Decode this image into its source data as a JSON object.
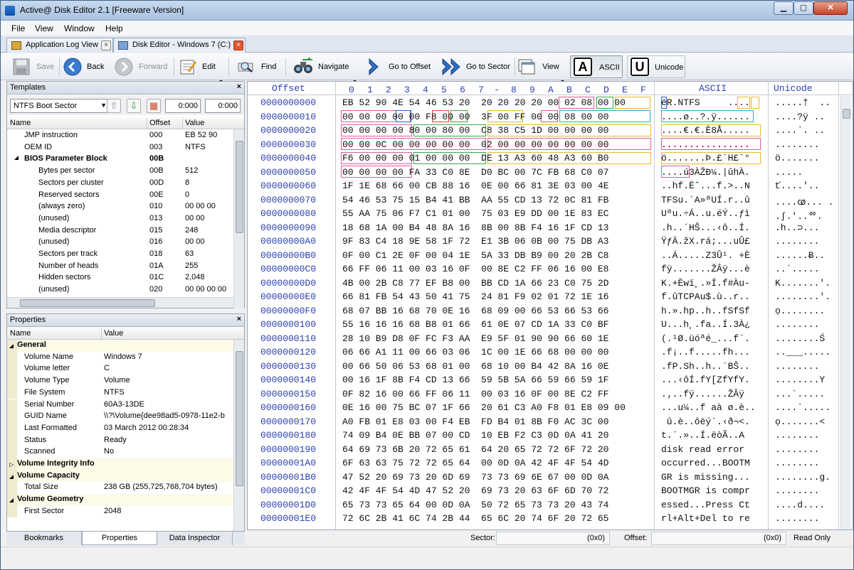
{
  "window": {
    "title": "Active@ Disk Editor 2.1 [Freeware Version]"
  },
  "menu": [
    "File",
    "View",
    "Window",
    "Help"
  ],
  "tabs": [
    {
      "label": "Application Log View"
    },
    {
      "label": "Disk Editor - Windows 7 (C:)"
    }
  ],
  "toolbar": {
    "save": "Save",
    "back": "Back",
    "forward": "Forward",
    "edit": "Edit",
    "find": "Find",
    "navigate": "Navigate",
    "go_offset": "Go to Offset",
    "go_sector": "Go to Sector",
    "view": "View",
    "ascii": "ASCII",
    "unicode": "Unicode",
    "ascii_glyph": "A",
    "unicode_glyph": "U"
  },
  "templates": {
    "title": "Templates",
    "close": "×",
    "selected": "NTFS Boot Sector",
    "field1": "0:000",
    "field2": "0:000",
    "columns": [
      "Name",
      "Offset",
      "Value"
    ],
    "rows": [
      {
        "name": "JMP instruction",
        "offset": "000",
        "value": "EB 52 90"
      },
      {
        "name": "OEM ID",
        "offset": "003",
        "value": "NTFS"
      },
      {
        "name": "BIOS Parameter Block",
        "offset": "00B",
        "value": ""
      },
      {
        "name": "Bytes per sector",
        "offset": "00B",
        "value": "512"
      },
      {
        "name": "Sectors per cluster",
        "offset": "00D",
        "value": "8"
      },
      {
        "name": "Reserved sectors",
        "offset": "00E",
        "value": "0"
      },
      {
        "name": "(always zero)",
        "offset": "010",
        "value": "00 00 00"
      },
      {
        "name": "(unused)",
        "offset": "013",
        "value": "00 00"
      },
      {
        "name": "Media descriptor",
        "offset": "015",
        "value": "248"
      },
      {
        "name": "(unused)",
        "offset": "016",
        "value": "00 00"
      },
      {
        "name": "Sectors per track",
        "offset": "018",
        "value": "63"
      },
      {
        "name": "Number of heads",
        "offset": "01A",
        "value": "255"
      },
      {
        "name": "Hidden sectors",
        "offset": "01C",
        "value": "2,048"
      },
      {
        "name": "(unused)",
        "offset": "020",
        "value": "00 00 00 00"
      }
    ]
  },
  "properties": {
    "title": "Properties",
    "close": "×",
    "columns": [
      "Name",
      "Value"
    ],
    "rows": [
      {
        "name": "General",
        "value": "",
        "cat": true,
        "exp": "◢"
      },
      {
        "name": "Volume Name",
        "value": "Windows 7"
      },
      {
        "name": "Volume letter",
        "value": "C"
      },
      {
        "name": "Volume Type",
        "value": "Volume"
      },
      {
        "name": "File System",
        "value": "NTFS"
      },
      {
        "name": "Serial Number",
        "value": "60A3-13DE"
      },
      {
        "name": "GUID Name",
        "value": "\\\\?\\Volume{dee98ad5-0978-11e2-b"
      },
      {
        "name": "Last Formatted",
        "value": "03 March 2012 00:28:34"
      },
      {
        "name": "Status",
        "value": "Ready"
      },
      {
        "name": "Scanned",
        "value": "No"
      },
      {
        "name": "Volume Integrity Info",
        "value": "",
        "cat": true,
        "exp": "▷"
      },
      {
        "name": "Volume Capacity",
        "value": "",
        "cat": true,
        "exp": "◢"
      },
      {
        "name": "Total Size",
        "value": "238 GB (255,725,768,704 bytes)"
      },
      {
        "name": "Volume Geometry",
        "value": "",
        "cat": true,
        "exp": "◢"
      },
      {
        "name": "First Sector",
        "value": "2048"
      }
    ]
  },
  "panel_tabs": [
    "Bookmarks",
    "Properties",
    "Data Inspector"
  ],
  "hex": {
    "header": {
      "offset": "Offset",
      "cols": [
        "0",
        "1",
        "2",
        "3",
        "4",
        "5",
        "6",
        "7",
        "-",
        "8",
        "9",
        "A",
        "B",
        "C",
        "D",
        "E",
        "F"
      ],
      "ascii": "ASCII",
      "unicode": "Unicode"
    },
    "rows": [
      {
        "off": "0000000000",
        "hex": "EB 52 90 4E 54 46 53 20  20 20 20 20 00 02 08 00 00",
        "asc": "ëR.NTFS     ....",
        "uni": ".....†  .."
      },
      {
        "off": "0000000010",
        "hex": "00 00 00 00 00 F8 00 00  3F 00 FF 00 00 08 00 00",
        "asc": "....ø..?.ÿ......",
        "uni": "....?ÿ .."
      },
      {
        "off": "0000000020",
        "hex": "00 00 00 00 80 00 80 00  C8 38 C5 1D 00 00 00 00",
        "asc": "....€.€.È8Å.....",
        "uni": "....`. .."
      },
      {
        "off": "0000000030",
        "hex": "00 00 0C 00 00 00 00 00  02 00 00 00 00 00 00 00",
        "asc": "................",
        "uni": "........"
      },
      {
        "off": "0000000040",
        "hex": "F6 00 00 00 01 00 00 00  DE 13 A3 60 48 A3 60 B0",
        "asc": "ö.......Þ.£`H£`°",
        "uni": "ö......."
      },
      {
        "off": "0000000050",
        "hex": "00 00 00 00 FA 33 C0 8E  D0 BC 00 7C FB 68 C0 07",
        "asc": "....ú3ÀŽÐ¼.|ûhÀ.",
        "uni": "....."
      },
      {
        "off": "0000000060",
        "hex": "1F 1E 68 66 00 CB 88 16  0E 00 66 81 3E 03 00 4E",
        "asc": "..hf.Ëˆ...f.>..N",
        "uni": "ť....'.."
      },
      {
        "off": "0000000070",
        "hex": "54 46 53 75 15 B4 41 BB  AA 55 CD 13 72 0C 81 FB",
        "asc": "TFSu.´A»ªUÍ.r..û",
        "uni": "....ꭄ... ."
      },
      {
        "off": "0000000080",
        "hex": "55 AA 75 06 F7 C1 01 00  75 03 E9 DD 00 1E 83 EC",
        "asc": "Uªu.÷Á..u.éÝ..ƒì",
        "uni": ".ʃ.'..ᅇ."
      },
      {
        "off": "0000000090",
        "hex": "18 68 1A 00 B4 48 8A 16  8B 00 8B F4 16 1F CD 13",
        "asc": ".h..´HŠ...‹ô..Í.",
        "uni": ".h..⊃..."
      },
      {
        "off": "00000000A0",
        "hex": "9F 83 C4 18 9E 58 1F 72  E1 3B 06 0B 00 75 DB A3",
        "asc": "ŸƒÄ.žX.rá;...uÛ£",
        "uni": "........"
      },
      {
        "off": "00000000B0",
        "hex": "0F 00 C1 2E 0F 00 04 1E  5A 33 DB B9 00 20 2B C8",
        "asc": "..Á.....Z3Û¹. +È",
        "uni": "......Ƀ.."
      },
      {
        "off": "00000000C0",
        "hex": "66 FF 06 11 00 03 16 0F  00 8E C2 FF 06 16 00 E8",
        "asc": "fÿ.......ŽÂÿ...è",
        "uni": "..`....."
      },
      {
        "off": "00000000D0",
        "hex": "4B 00 2B C8 77 EF B8 00  BB CD 1A 66 23 C0 75 2D",
        "asc": "K.+Èwï¸.»Í.f#Àu-",
        "uni": "K.......'."
      },
      {
        "off": "00000000E0",
        "hex": "66 81 FB 54 43 50 41 75  24 81 F9 02 01 72 1E 16",
        "asc": "f.ûTCPAu$.ù..r..",
        "uni": "........'."
      },
      {
        "off": "00000000F0",
        "hex": "68 07 BB 16 68 70 0E 16  68 09 00 66 53 66 53 66",
        "asc": "h.».hp..h..fSfSf",
        "uni": "ọ........"
      },
      {
        "off": "0000000100",
        "hex": "55 16 16 16 68 B8 01 66  61 0E 07 CD 1A 33 C0 BF",
        "asc": "U...h¸.fa..Í.3À¿",
        "uni": "........"
      },
      {
        "off": "0000000110",
        "hex": "28 10 B9 D8 0F FC F3 AA  E9 5F 01 90 90 66 60 1E",
        "asc": "(.¹Ø.üóªé_...f`.",
        "uni": "........Ś"
      },
      {
        "off": "0000000120",
        "hex": "06 66 A1 11 00 66 03 06  1C 00 1E 66 68 00 00 00",
        "asc": ".f¡..f.....fh...",
        "uni": "..___....."
      },
      {
        "off": "0000000130",
        "hex": "00 66 50 06 53 68 01 00  68 10 00 B4 42 8A 16 0E",
        "asc": ".fP.Sh..h..´BŠ..",
        "uni": "........"
      },
      {
        "off": "0000000140",
        "hex": "00 16 1F 8B F4 CD 13 66  59 5B 5A 66 59 66 59 1F",
        "asc": "...‹ôÍ.fY[ZfYfY.",
        "uni": "........Y"
      },
      {
        "off": "0000000150",
        "hex": "0F 82 16 00 66 FF 06 11  00 03 16 0F 00 8E C2 FF",
        "asc": ".‚..fÿ......ŽÂÿ",
        "uni": "...`....."
      },
      {
        "off": "0000000160",
        "hex": "0E 16 00 75 BC 07 1F 66  20 61 C3 A0 F8 01 E8 09 00",
        "asc": "...u¼..f aà ø.è..",
        "uni": "....`....."
      },
      {
        "off": "0000000170",
        "hex": "A0 FB 01 E8 03 00 F4 EB  FD B4 01 8B F0 AC 3C 00",
        "asc": " û.è..ôëý´.‹ð¬<.",
        "uni": "ọ.......<"
      },
      {
        "off": "0000000180",
        "hex": "74 09 B4 0E BB 07 00 CD  10 EB F2 C3 0D 0A 41 20",
        "asc": "t.´.»..Í.ëòÃ..A ",
        "uni": "........"
      },
      {
        "off": "0000000190",
        "hex": "64 69 73 6B 20 72 65 61  64 20 65 72 72 6F 72 20",
        "asc": "disk read error ",
        "uni": "........"
      },
      {
        "off": "00000001A0",
        "hex": "6F 63 63 75 72 72 65 64  00 0D 0A 42 4F 4F 54 4D",
        "asc": "occurred...BOOTM",
        "uni": "........"
      },
      {
        "off": "00000001B0",
        "hex": "47 52 20 69 73 20 6D 69  73 73 69 6E 67 00 0D 0A",
        "asc": "GR is missing...",
        "uni": "........g."
      },
      {
        "off": "00000001C0",
        "hex": "42 4F 4F 54 4D 47 52 20  69 73 20 63 6F 6D 70 72",
        "asc": "BOOTMGR is compr",
        "uni": "........"
      },
      {
        "off": "00000001D0",
        "hex": "65 73 73 65 64 00 0D 0A  50 72 65 73 73 20 43 74",
        "asc": "essed...Press Ct",
        "uni": "....d...."
      },
      {
        "off": "00000001E0",
        "hex": "72 6C 2B 41 6C 74 2B 44  65 6C 20 74 6F 20 72 65",
        "asc": "rl+Alt+Del to re",
        "uni": "........"
      }
    ]
  },
  "status": {
    "sector_label": "Sector:",
    "sector_value": "(0x0)",
    "offset_label": "Offset:",
    "offset_value": "(0x0)",
    "mode": "Read Only"
  },
  "colors": {
    "accent": "#2a3fb0",
    "title_bar": "#b9cde8"
  }
}
